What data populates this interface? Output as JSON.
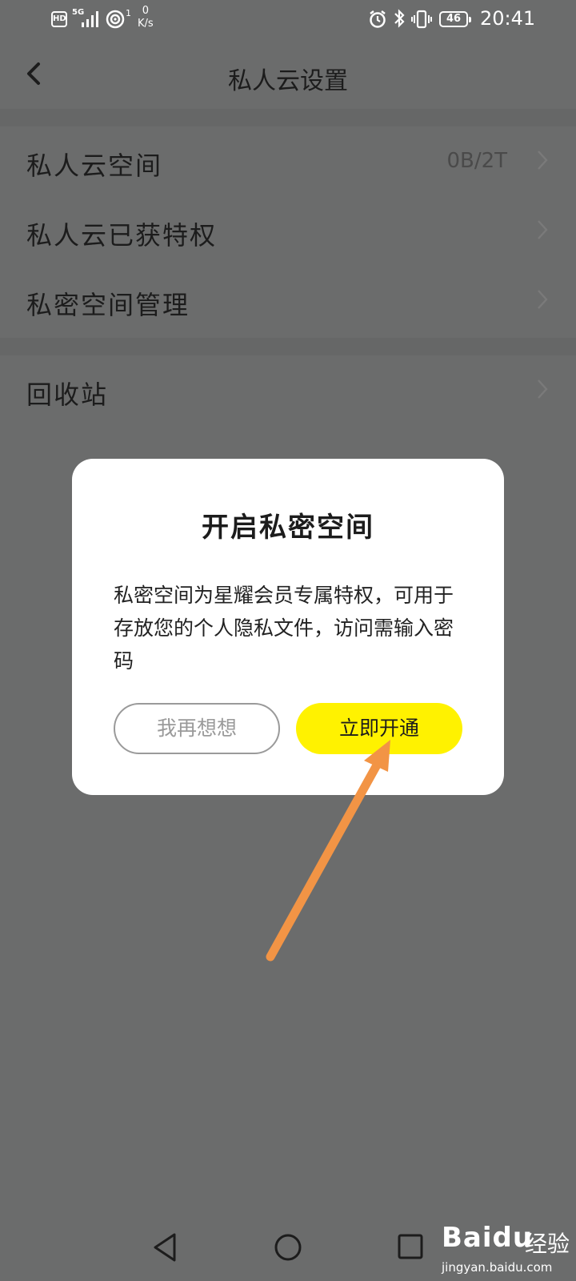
{
  "status_bar": {
    "network_badge": "HD",
    "network_type": "5G",
    "hotspot_count": "1",
    "speed_value": "0",
    "speed_unit": "K/s",
    "battery": "46",
    "time": "20:41"
  },
  "header": {
    "title": "私人云设置"
  },
  "settings": {
    "group1": [
      {
        "label": "私人云空间",
        "value": "0B/2T"
      },
      {
        "label": "私人云已获特权",
        "value": ""
      },
      {
        "label": "私密空间管理",
        "value": ""
      }
    ],
    "group2": [
      {
        "label": "回收站",
        "value": ""
      }
    ]
  },
  "dialog": {
    "title": "开启私密空间",
    "body": "私密空间为星耀会员专属特权，可用于存放您的个人隐私文件，访问需输入密码",
    "cancel_label": "我再想想",
    "confirm_label": "立即开通"
  },
  "watermark": {
    "logo": "Baidu",
    "suffix": "经验",
    "url": "jingyan.baidu.com"
  },
  "colors": {
    "accent": "#fff200",
    "overlay_background": "#6b6c6c",
    "arrow": "#f29445"
  }
}
